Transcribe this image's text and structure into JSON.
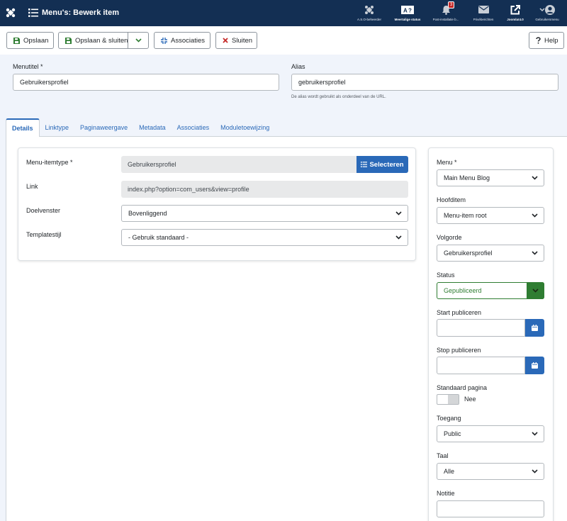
{
  "header": {
    "title": "Menu's: Bewerk item",
    "items": [
      {
        "label": "A.S.O-beheerder",
        "icon": "joomla-x-icon"
      },
      {
        "label": "Meertalige status",
        "icon": "translate-icon"
      },
      {
        "label": "Post-installatie b...",
        "icon": "bell-icon",
        "badge": "3"
      },
      {
        "label": "Privéberichten",
        "icon": "envelope-icon"
      },
      {
        "label": "Joomla!4.0",
        "icon": "external-link-icon"
      },
      {
        "label": "Gebruikersmenu",
        "icon": "user-icon"
      }
    ]
  },
  "toolbar": {
    "save": "Opslaan",
    "save_close": "Opslaan & sluiten",
    "associations": "Associaties",
    "close": "Sluiten",
    "help": "Help"
  },
  "fields": {
    "menutitle_label": "Menutitel *",
    "menutitle_value": "Gebruikersprofiel",
    "alias_label": "Alias",
    "alias_value": "gebruikersprofiel",
    "alias_help": "De alias wordt gebruikt als onderdeel van de URL."
  },
  "tabs": [
    "Details",
    "Linktype",
    "Paginaweergave",
    "Metadata",
    "Associaties",
    "Moduletoewijzing"
  ],
  "details": {
    "itemtype_label": "Menu-itemtype *",
    "itemtype_value": "Gebruikersprofiel",
    "select_button": "Selecteren",
    "link_label": "Link",
    "link_value": "index.php?option=com_users&view=profile",
    "target_label": "Doelvenster",
    "target_value": "Bovenliggend",
    "template_label": "Templatestijl",
    "template_value": "- Gebruik standaard -"
  },
  "sidebar": {
    "menu_label": "Menu *",
    "menu_value": "Main Menu Blog",
    "parent_label": "Hoofditem",
    "parent_value": "Menu-item root",
    "order_label": "Volgorde",
    "order_value": "Gebruikersprofiel",
    "status_label": "Status",
    "status_value": "Gepubliceerd",
    "publish_up_label": "Start publiceren",
    "publish_down_label": "Stop publiceren",
    "home_label": "Standaard pagina",
    "home_value": "Nee",
    "access_label": "Toegang",
    "access_value": "Public",
    "language_label": "Taal",
    "language_value": "Alle",
    "note_label": "Notitie"
  },
  "colors": {
    "header_bg": "#132f53",
    "primary": "#2a69b8",
    "success": "#2f7d32",
    "danger": "#c52827"
  }
}
